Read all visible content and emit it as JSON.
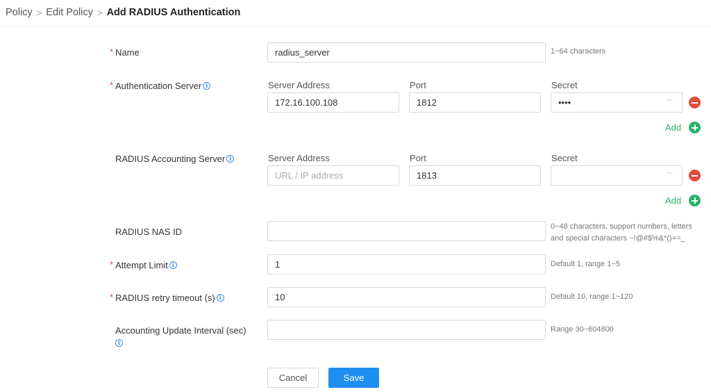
{
  "breadcrumb": {
    "items": [
      "Policy",
      "Edit Policy"
    ],
    "current": "Add RADIUS Authentication"
  },
  "form": {
    "name": {
      "label": "Name",
      "value": "radius_server",
      "hint": "1~64 characters"
    },
    "auth_server": {
      "label": "Authentication Server",
      "col_address": "Server Address",
      "col_port": "Port",
      "col_secret": "Secret",
      "address": "172.16.100.108",
      "port": "1812",
      "secret": "••••",
      "add_label": "Add"
    },
    "acct_server": {
      "label": "RADIUS Accounting Server",
      "col_address": "Server Address",
      "col_port": "Port",
      "col_secret": "Secret",
      "address_placeholder": "URL / IP address",
      "port": "1813",
      "secret": "",
      "add_label": "Add"
    },
    "nas_id": {
      "label": "RADIUS NAS ID",
      "value": "",
      "hint_line1": "0~48 characters, support numbers, letters",
      "hint_line2": "and special characters ~!@#$%&*()+=_"
    },
    "attempt_limit": {
      "label": "Attempt Limit",
      "value": "1",
      "hint": "Default 1, range 1~5"
    },
    "retry_timeout": {
      "label": "RADIUS retry timeout (s)",
      "value": "10",
      "hint": "Default 10, range 1~120"
    },
    "acct_interval": {
      "label": "Accounting Update Interval (sec)",
      "value": "",
      "hint": "Range 30~604800"
    }
  },
  "buttons": {
    "cancel": "Cancel",
    "save": "Save"
  },
  "colors": {
    "required": "#e64a3b",
    "add": "#26b36b",
    "remove": "#e64a3b",
    "primary": "#1f8ef1",
    "info": "#3a8ee6"
  }
}
